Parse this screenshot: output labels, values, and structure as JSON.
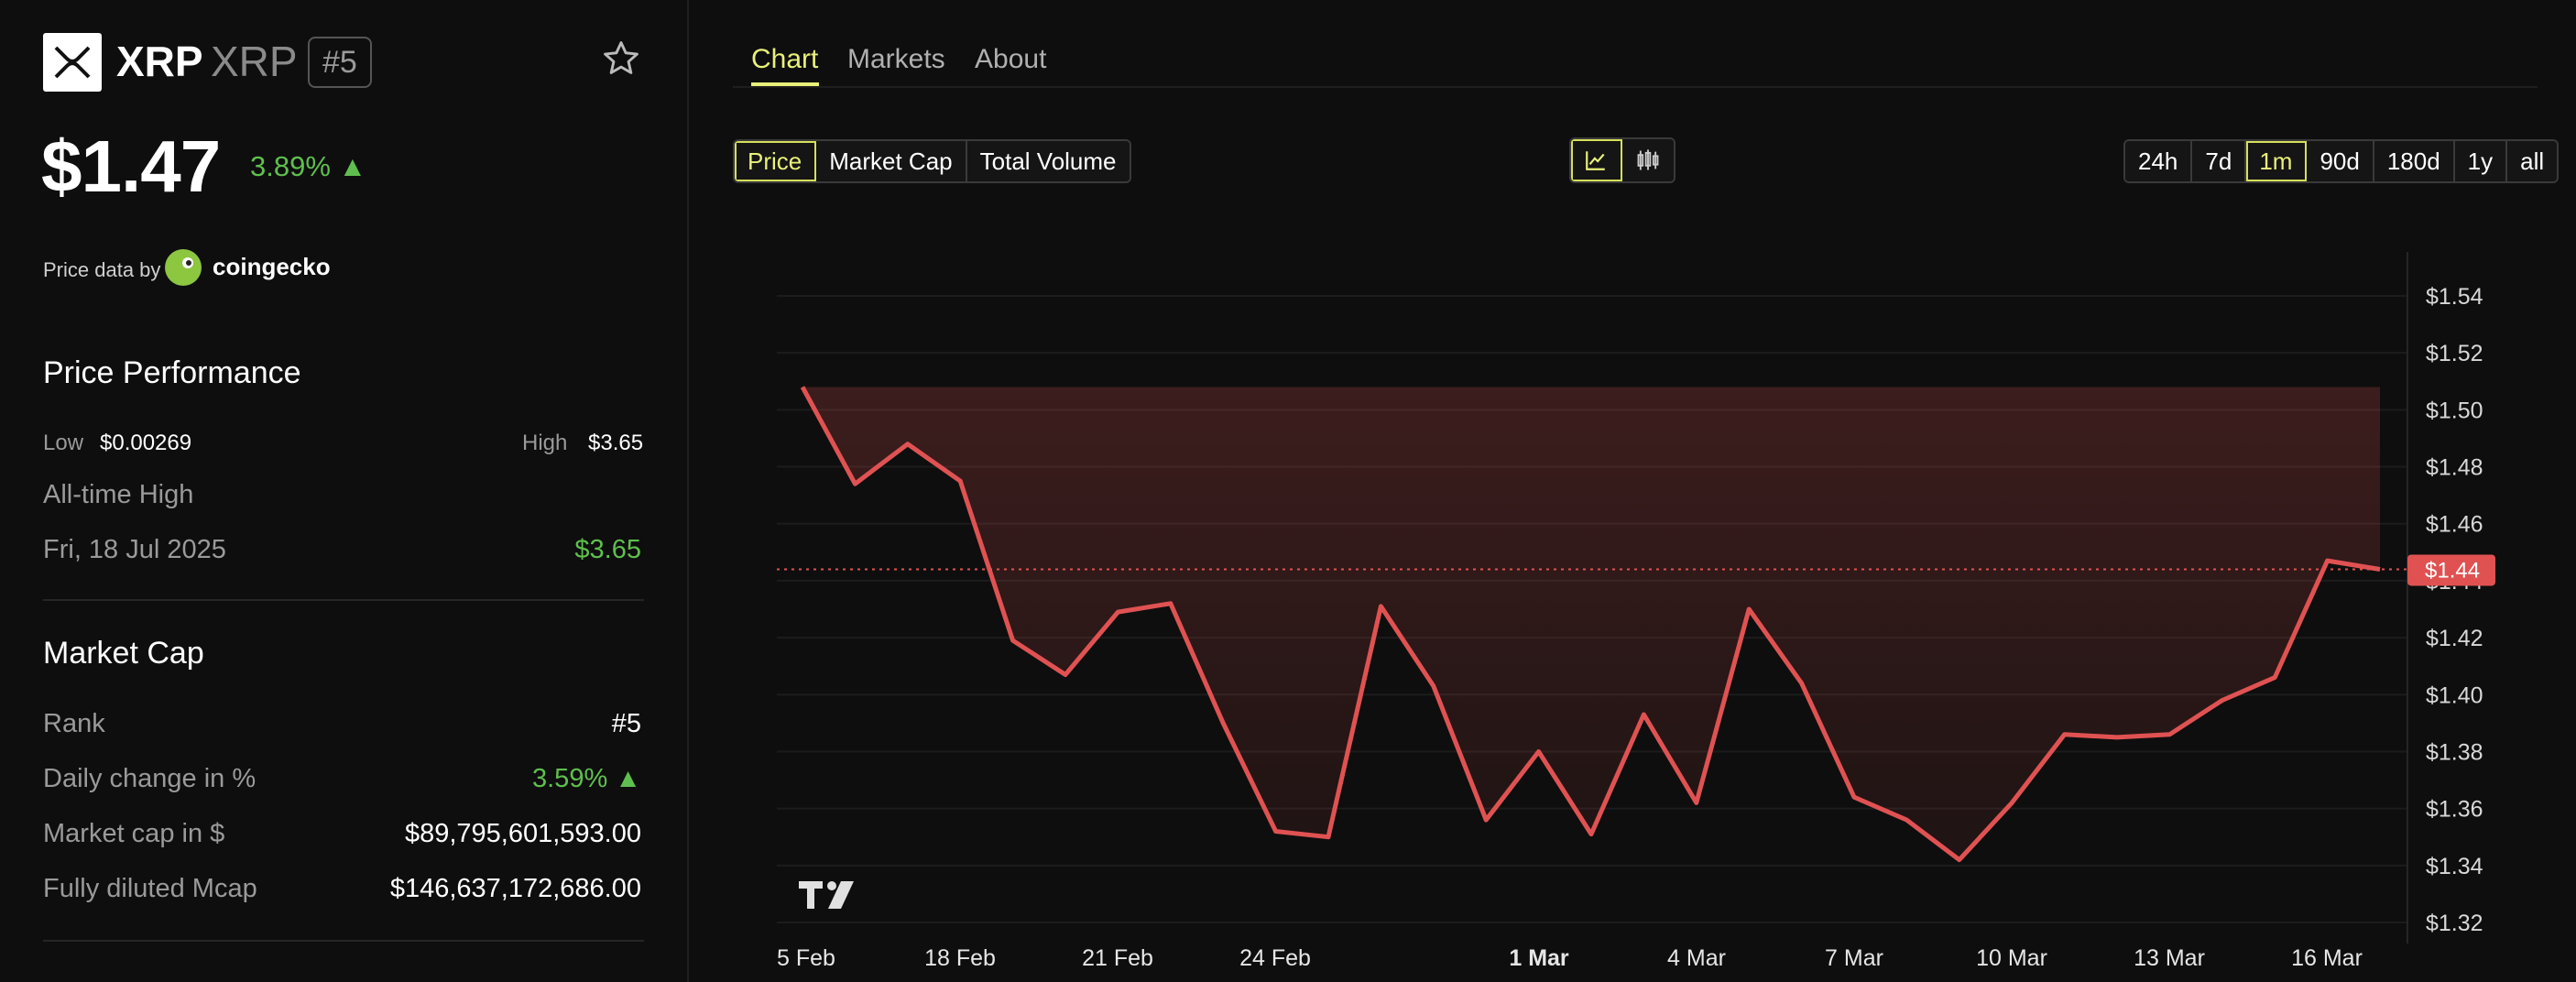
{
  "coin": {
    "name": "XRP",
    "symbol": "XRP",
    "rank": "#5",
    "price": "$1.47",
    "change": "3.89% ▲",
    "price_data_label": "Price data by",
    "provider": "coingecko"
  },
  "performance": {
    "title": "Price Performance",
    "low_label": "Low",
    "low_value": "$0.00269",
    "high_label": "High",
    "high_value": "$3.65",
    "ath_label": "All-time High",
    "ath_date": "Fri, 18 Jul 2025",
    "ath_value": "$3.65"
  },
  "market_cap": {
    "title": "Market Cap",
    "rows": [
      {
        "label": "Rank",
        "value": "#5"
      },
      {
        "label": "Daily change in %",
        "value": "3.59% ▲"
      },
      {
        "label": "Market cap in $",
        "value": "$89,795,601,593.00"
      },
      {
        "label": "Fully diluted Mcap",
        "value": "$146,637,172,686.00"
      }
    ]
  },
  "tabs": [
    "Chart",
    "Markets",
    "About"
  ],
  "metric_buttons": [
    "Price",
    "Market Cap",
    "Total Volume"
  ],
  "range_buttons": [
    "24h",
    "7d",
    "1m",
    "90d",
    "180d",
    "1y",
    "all"
  ],
  "colors": {
    "accent": "#e9f07a",
    "green": "#5fbf4e",
    "line": "#e05252"
  },
  "chart_data": {
    "type": "area",
    "current_price_label": "$1.44",
    "ylim": [
      1.32,
      1.55
    ],
    "y_ticks": [
      "$1.54",
      "$1.52",
      "$1.50",
      "$1.48",
      "$1.46",
      "$1.44",
      "$1.42",
      "$1.40",
      "$1.38",
      "$1.36",
      "$1.34",
      "$1.32"
    ],
    "x_ticks": [
      "5 Feb",
      "18 Feb",
      "21 Feb",
      "24 Feb",
      "1 Mar",
      "4 Mar",
      "7 Mar",
      "10 Mar",
      "13 Mar",
      "16 Mar"
    ],
    "series": [
      {
        "values": [
          1.508,
          1.474,
          1.488,
          1.475,
          1.419,
          1.407,
          1.429,
          1.432,
          1.39,
          1.352,
          1.35,
          1.431,
          1.403,
          1.356,
          1.38,
          1.351,
          1.393,
          1.362,
          1.43,
          1.404,
          1.364,
          1.356,
          1.342,
          1.362,
          1.386,
          1.385,
          1.386,
          1.398,
          1.406,
          1.447,
          1.444
        ]
      }
    ]
  }
}
